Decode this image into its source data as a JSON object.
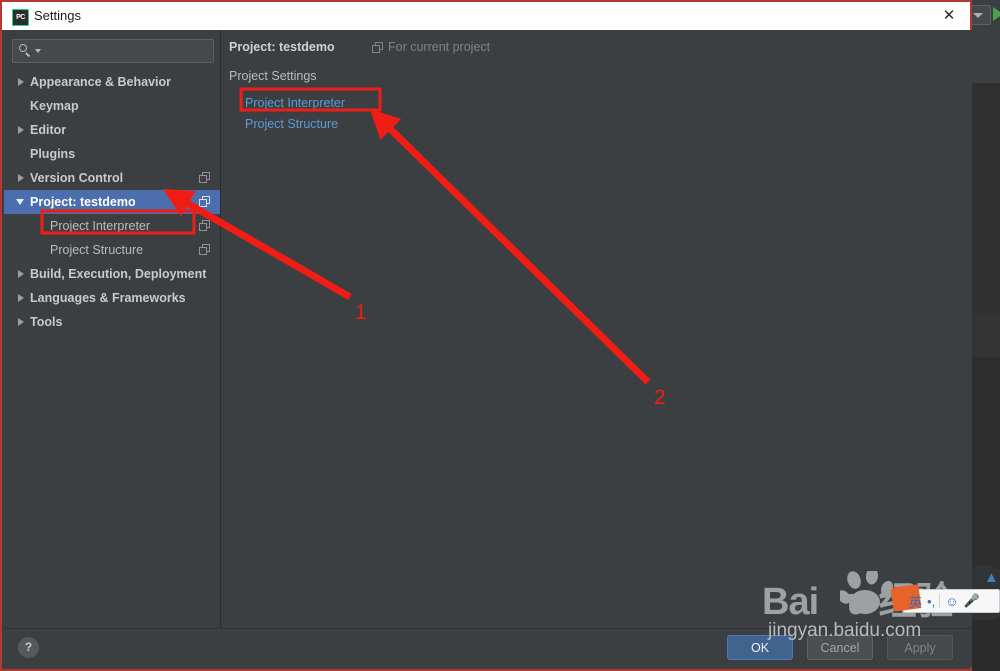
{
  "window": {
    "title": "Settings",
    "app_icon": "pycharm-icon",
    "close_label": "✕"
  },
  "search": {
    "value": "",
    "placeholder": ""
  },
  "sidebar": {
    "items": [
      {
        "label": "Appearance & Behavior",
        "twisty": "closed",
        "level": 0,
        "bold": true,
        "selected": false,
        "copy_icon": false
      },
      {
        "label": "Keymap",
        "twisty": "none",
        "level": 0,
        "bold": true,
        "selected": false,
        "copy_icon": false
      },
      {
        "label": "Editor",
        "twisty": "closed",
        "level": 0,
        "bold": true,
        "selected": false,
        "copy_icon": false
      },
      {
        "label": "Plugins",
        "twisty": "none",
        "level": 0,
        "bold": true,
        "selected": false,
        "copy_icon": false
      },
      {
        "label": "Version Control",
        "twisty": "closed",
        "level": 0,
        "bold": true,
        "selected": false,
        "copy_icon": true
      },
      {
        "label": "Project: testdemo",
        "twisty": "open",
        "level": 0,
        "bold": true,
        "selected": true,
        "copy_icon": true
      },
      {
        "label": "Project Interpreter",
        "twisty": "none",
        "level": 1,
        "bold": false,
        "selected": false,
        "copy_icon": true
      },
      {
        "label": "Project Structure",
        "twisty": "none",
        "level": 1,
        "bold": false,
        "selected": false,
        "copy_icon": true
      },
      {
        "label": "Build, Execution, Deployment",
        "twisty": "closed",
        "level": 0,
        "bold": true,
        "selected": false,
        "copy_icon": false
      },
      {
        "label": "Languages & Frameworks",
        "twisty": "closed",
        "level": 0,
        "bold": true,
        "selected": false,
        "copy_icon": false
      },
      {
        "label": "Tools",
        "twisty": "closed",
        "level": 0,
        "bold": true,
        "selected": false,
        "copy_icon": false
      }
    ]
  },
  "content": {
    "title": "Project: testdemo",
    "scope_note": "For current project",
    "section_label": "Project Settings",
    "links": [
      {
        "label": "Project Interpreter"
      },
      {
        "label": "Project Structure"
      }
    ]
  },
  "footer": {
    "help_label": "?",
    "ok_label": "OK",
    "cancel_label": "Cancel",
    "apply_label": "Apply"
  },
  "annotations": {
    "marker_1": "1",
    "marker_2": "2",
    "color": "#f01c16"
  },
  "watermark": {
    "main": "Bai  du 经验",
    "sub": "jingyan.baidu.com"
  },
  "ime": {
    "lang_label": "英",
    "punct_label": "•,",
    "emoji_label": "☺",
    "mic_label": "🎤"
  },
  "colors": {
    "dialog_bg": "#3c3f41",
    "selection_blue": "#4b6eaf",
    "link_blue": "#5a9bd8",
    "annotation_red": "#f01c16",
    "dialog_border_red": "#b03a32",
    "ok_button": "#41648e"
  }
}
